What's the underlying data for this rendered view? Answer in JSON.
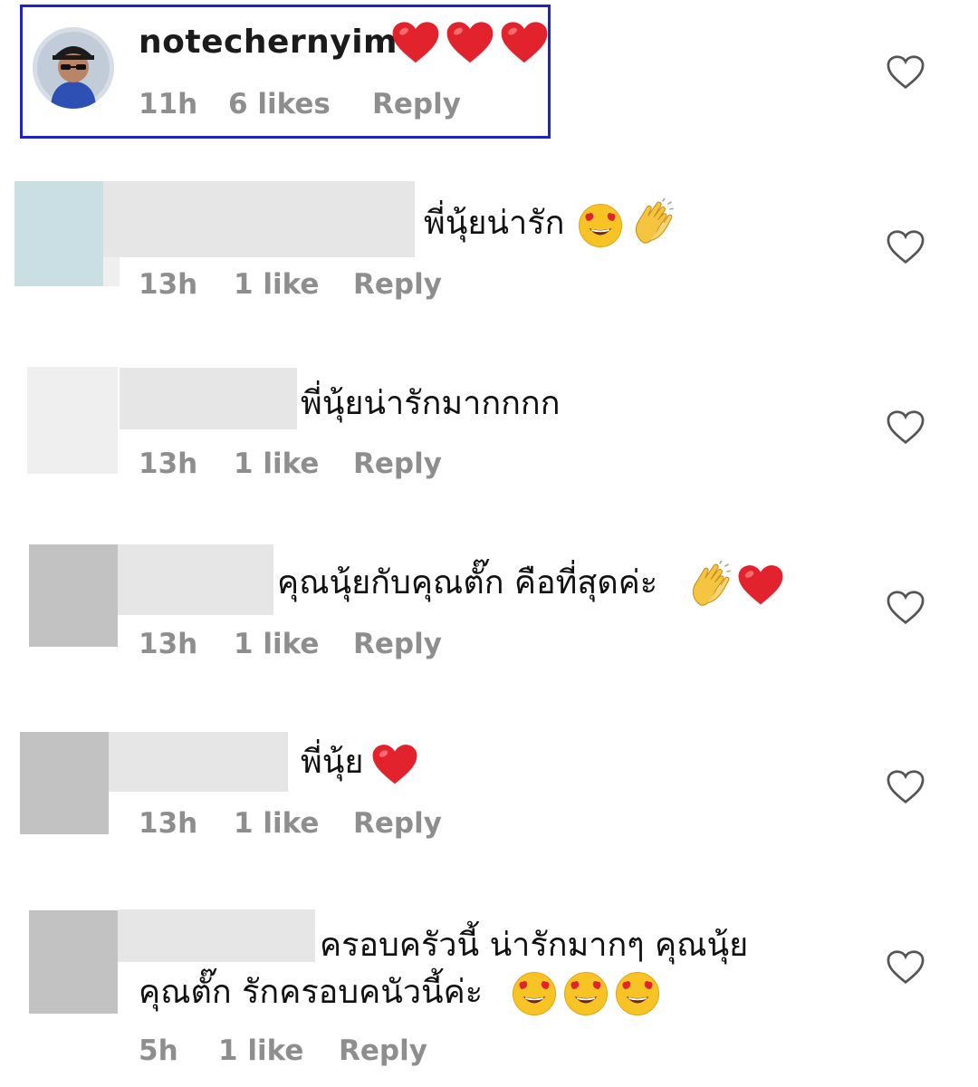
{
  "highlight_color": "#1f22c8",
  "comments": [
    {
      "username": "notecherny im",
      "username_text": "notechernyim",
      "emojis": [
        "red-heart",
        "red-heart",
        "red-heart"
      ],
      "time": "11h",
      "likes": "6 likes",
      "reply": "Reply"
    },
    {
      "text": "พี่นุ้ยน่ารัก",
      "emojis": [
        "heart-eyes-face",
        "clapping-hands"
      ],
      "time": "13h",
      "likes": "1 like",
      "reply": "Reply"
    },
    {
      "text": "พี่นุ้ยน่ารักมากกกก",
      "time": "13h",
      "likes": "1 like",
      "reply": "Reply"
    },
    {
      "text": "คุณนุ้ยกับคุณตั๊ก คือที่สุดค่ะ",
      "emojis": [
        "clapping-hands",
        "red-heart"
      ],
      "time": "13h",
      "likes": "1 like",
      "reply": "Reply"
    },
    {
      "text": "พี่นุ้ย",
      "emojis": [
        "red-heart"
      ],
      "time": "13h",
      "likes": "1 like",
      "reply": "Reply"
    },
    {
      "text_line1": "ครอบครัวนี้ น่ารักมากๆ คุณนุ้ย",
      "text_line2": "คุณตั๊ก  รักครอบคนัวนี้ค่ะ",
      "emojis": [
        "heart-eyes-face",
        "heart-eyes-face",
        "heart-eyes-face"
      ],
      "time": "5h",
      "likes": "1 like",
      "reply": "Reply"
    }
  ],
  "like_icon": "heart-outline-icon"
}
